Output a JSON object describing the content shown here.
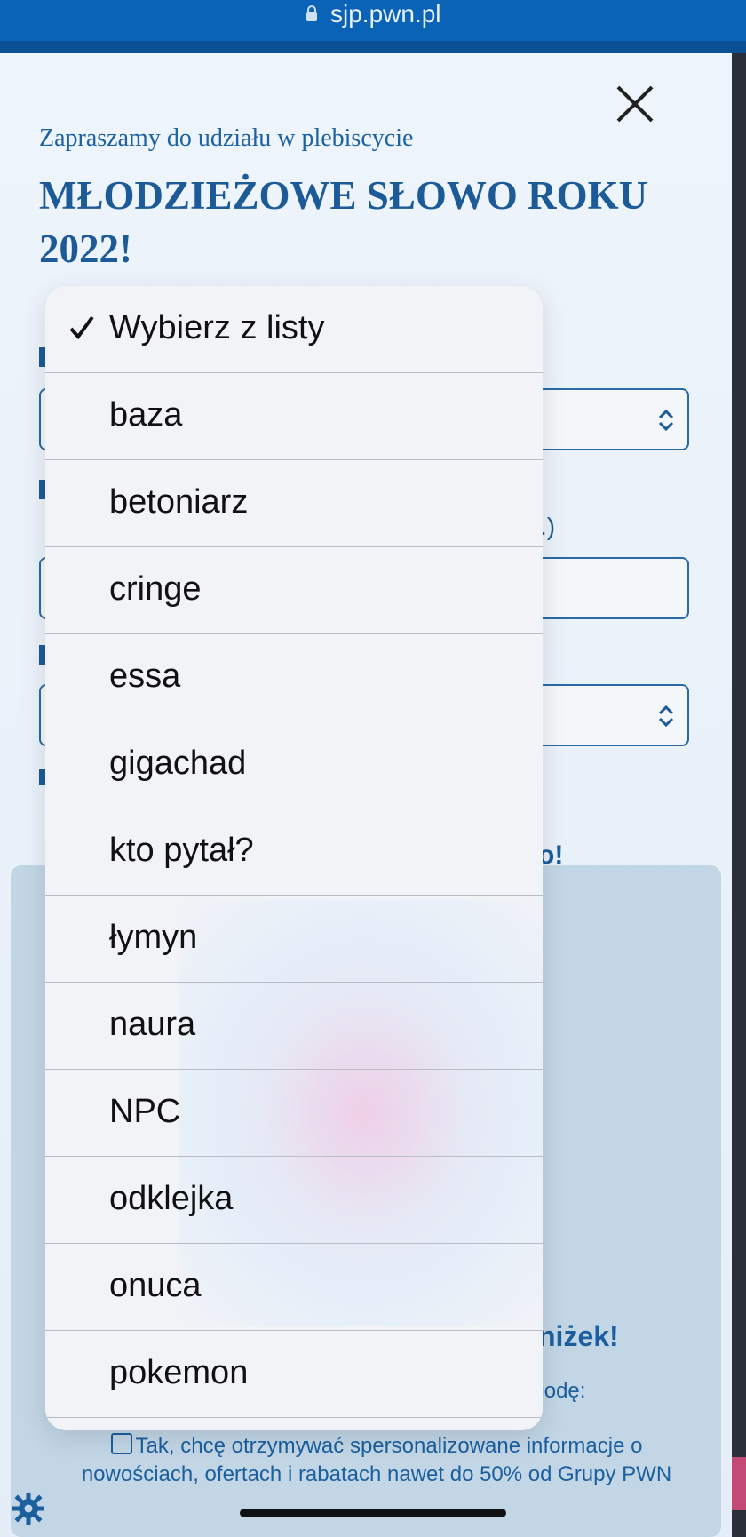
{
  "browser": {
    "url": "sjp.pwn.pl"
  },
  "modal": {
    "intro": "Zapraszamy do udziału w plebiscycie",
    "headline": "MŁODZIEŻOWE SŁOWO ROKU 2022!",
    "peek": {
      "fragment_paren_right": ".)",
      "panel_fragment_1": "o!",
      "panel_fragment_2": "niżek!"
    },
    "ebook_consent": "Aby otrzymać e-booka, wyraź poniższą zgodę:",
    "checkbox_text": "Tak, chcę otrzymywać spersonalizowane informacje o nowościach, ofertach i rabatach nawet do 50% od Grupy PWN"
  },
  "picker": {
    "selected_index": 0,
    "options": [
      {
        "label": "Wybierz z listy"
      },
      {
        "label": "baza"
      },
      {
        "label": "betoniarz"
      },
      {
        "label": "cringe"
      },
      {
        "label": "essa"
      },
      {
        "label": "gigachad"
      },
      {
        "label": "kto pytał?"
      },
      {
        "label": "łymyn"
      },
      {
        "label": "naura"
      },
      {
        "label": "NPC"
      },
      {
        "label": "odklejka"
      },
      {
        "label": "onuca"
      },
      {
        "label": "pokemon"
      }
    ]
  },
  "colors": {
    "brand_blue": "#1c5a98",
    "safari_bar": "#0a63b7",
    "picker_bg": "#f2f3f7"
  }
}
